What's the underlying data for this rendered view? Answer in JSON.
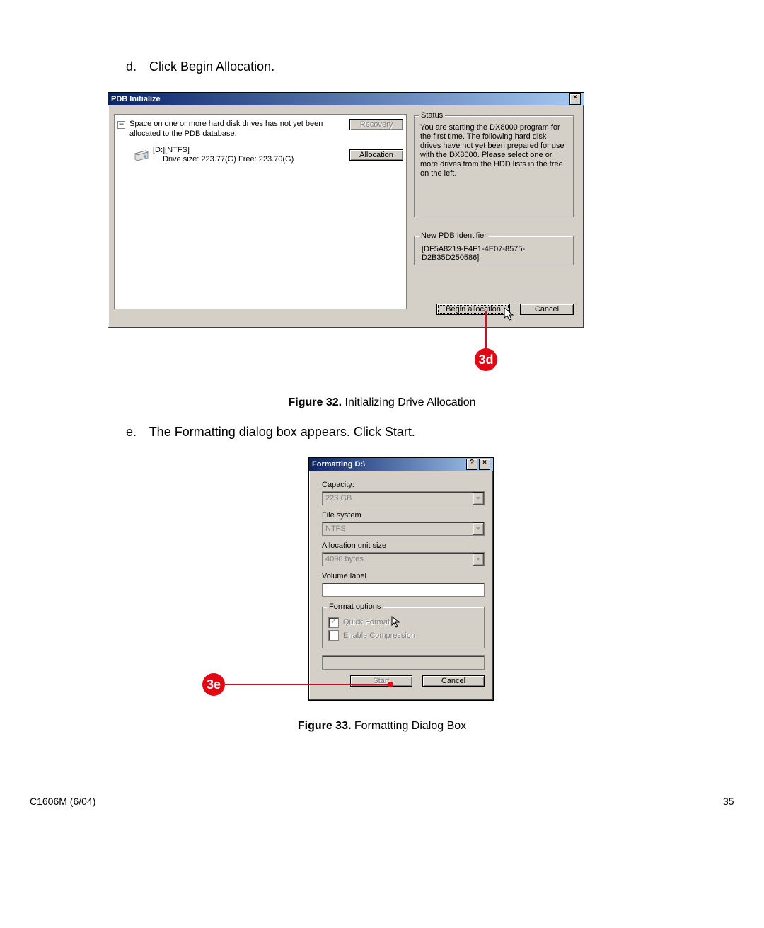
{
  "doc": {
    "step_d_letter": "d.",
    "step_d_text": "Click Begin Allocation.",
    "step_e_letter": "e.",
    "step_e_text": "The Formatting dialog box appears. Click Start.",
    "fig32_bold": "Figure 32.",
    "fig32_text": " Initializing Drive Allocation",
    "fig33_bold": "Figure 33.",
    "fig33_text": " Formatting Dialog Box",
    "footer_left": "C1606M (6/04)",
    "footer_right": "35"
  },
  "callouts": {
    "c3d": "3d",
    "c3e": "3e"
  },
  "pdb": {
    "title": "PDB Initialize",
    "close_x": "×",
    "tree_minus": "–",
    "root_text": "Space on one or more hard disk drives has not yet been allocated to the PDB database.",
    "recovery_btn": "Recovery",
    "drive_name": "[D:][NTFS]",
    "drive_info": "Drive size: 223.77(G) Free: 223.70(G)",
    "allocation_btn": "Allocation",
    "status_label": "Status",
    "status_text": "You are starting the DX8000 program for the first time. The following hard disk drives have not yet been prepared for use with the DX8000. Please select one or more drives from the HDD lists in the tree on the left.",
    "pdbid_label": "New PDB Identifier",
    "pdbid_value": "[DF5A8219-F4F1-4E07-8575-D2B35D250586]",
    "begin_btn": "Begin allocation",
    "cancel_btn": "Cancel"
  },
  "format": {
    "title": "Formatting D:\\",
    "help_q": "?",
    "close_x": "×",
    "capacity_label": "Capacity:",
    "capacity_value": "223 GB",
    "fs_label": "File system",
    "fs_value": "NTFS",
    "aus_label": "Allocation unit size",
    "aus_value": "4096 bytes",
    "vl_label": "Volume label",
    "vl_value": "",
    "options_label": "Format options",
    "quick_label": "Quick Format",
    "compress_label": "Enable Compression",
    "start_btn": "Start",
    "cancel_btn": "Cancel",
    "check_mark": "✓"
  }
}
